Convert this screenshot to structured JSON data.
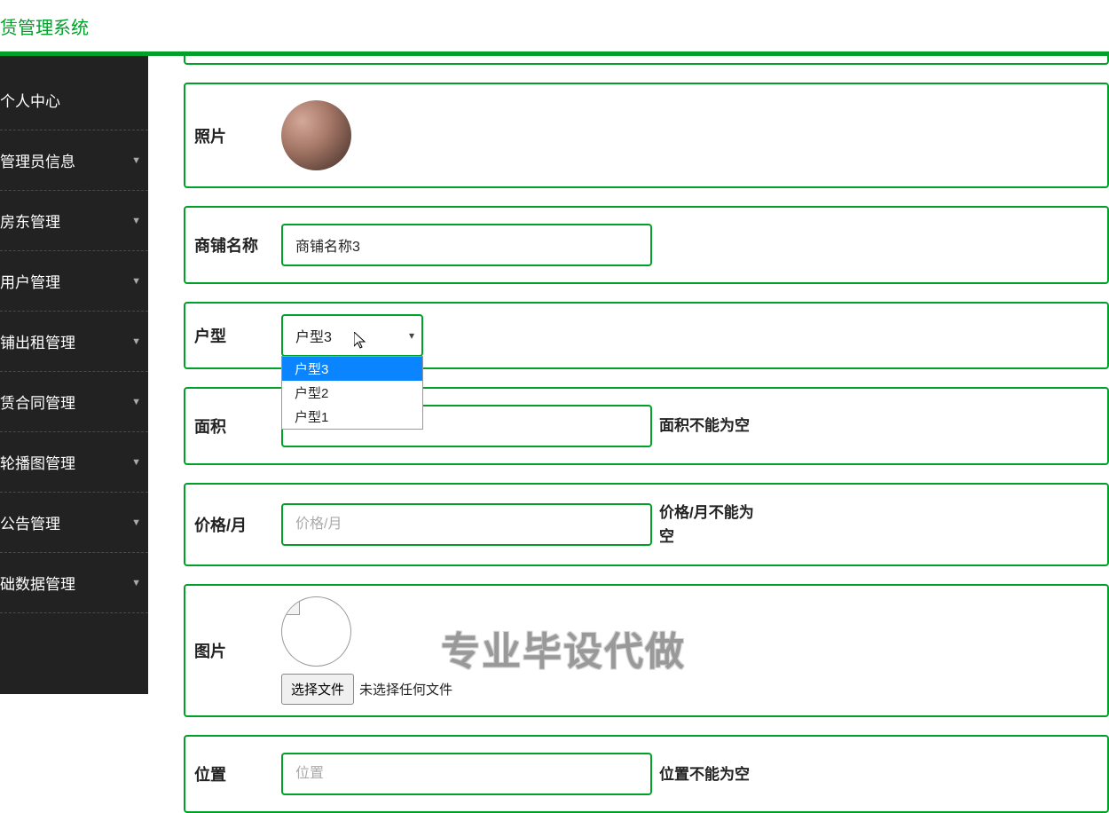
{
  "header": {
    "title": "赁管理系统"
  },
  "sidebar": {
    "items": [
      {
        "label": "个人中心"
      },
      {
        "label": "管理员信息"
      },
      {
        "label": "房东管理"
      },
      {
        "label": "用户管理"
      },
      {
        "label": "铺出租管理"
      },
      {
        "label": "赁合同管理"
      },
      {
        "label": "轮播图管理"
      },
      {
        "label": "公告管理"
      },
      {
        "label": "础数据管理"
      }
    ]
  },
  "form": {
    "photo": {
      "label": "照片"
    },
    "shopName": {
      "label": "商铺名称",
      "value": "商铺名称3"
    },
    "unitType": {
      "label": "户型",
      "selected": "户型3",
      "options": [
        "户型3",
        "户型2",
        "户型1"
      ]
    },
    "area": {
      "label": "面积",
      "value": "",
      "error": "面积不能为空"
    },
    "price": {
      "label": "价格/月",
      "placeholder": "价格/月",
      "value": "",
      "error": "价格/月不能为空"
    },
    "image": {
      "label": "图片",
      "buttonLabel": "选择文件",
      "status": "未选择任何文件"
    },
    "location": {
      "label": "位置",
      "placeholder": "位置",
      "value": "",
      "error": "位置不能为空"
    }
  },
  "watermark": "专业毕设代做"
}
